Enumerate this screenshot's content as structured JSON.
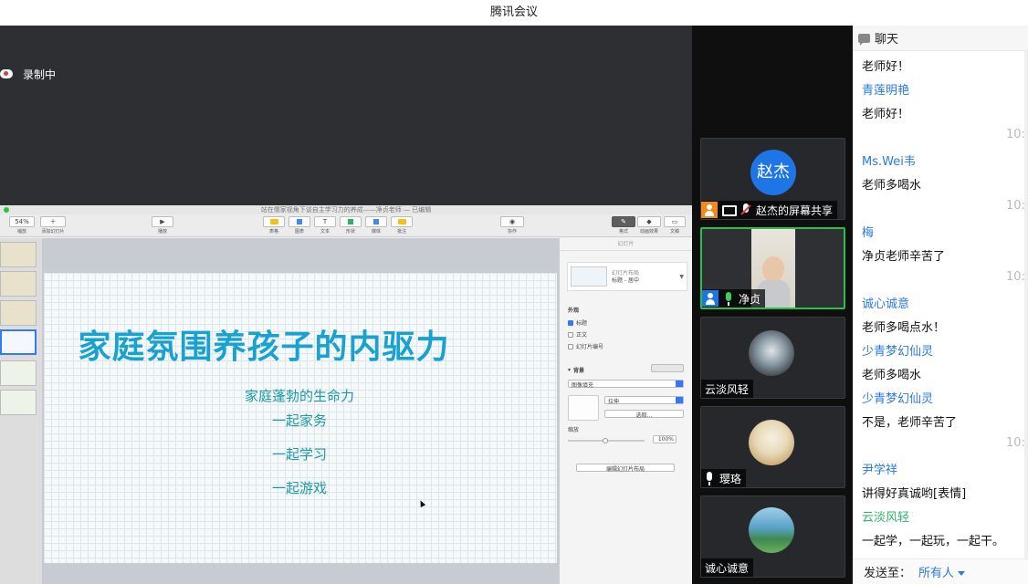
{
  "app_title": "腾讯会议",
  "recording": {
    "label": "录制中"
  },
  "keynote": {
    "doc_title": "站在儒家视角下谈自主学习力的养成——净贞老师 — 已编辑",
    "toolbar": [
      {
        "key": "zoom",
        "label": "缩放",
        "value": "54%"
      },
      {
        "key": "add_slide",
        "label": "添加幻灯片",
        "value": "＋"
      },
      {
        "key": "play",
        "label": "播放",
        "value": "▶"
      },
      {
        "key": "table",
        "label": "表格"
      },
      {
        "key": "chart",
        "label": "图表"
      },
      {
        "key": "text",
        "label": "文本",
        "value": "T"
      },
      {
        "key": "shape",
        "label": "形状"
      },
      {
        "key": "media",
        "label": "媒体"
      },
      {
        "key": "comment",
        "label": "批注"
      },
      {
        "key": "collab",
        "label": "协作"
      },
      {
        "key": "format",
        "label": "格式"
      },
      {
        "key": "animate",
        "label": "动画效果"
      },
      {
        "key": "document",
        "label": "文稿"
      }
    ],
    "slide": {
      "title": "家庭氛围养孩子的内驱力",
      "lines": [
        "家庭蓬勃的生命力",
        "一起家务",
        "一起学习",
        "一起游戏"
      ]
    },
    "inspector": {
      "header": "幻灯片",
      "layout_label": "幻灯片布局",
      "layout_value": "标题 - 居中",
      "appearance": "外观",
      "checkboxes": [
        {
          "label": "标题",
          "checked": true
        },
        {
          "label": "正文",
          "checked": false
        },
        {
          "label": "幻灯片编号",
          "checked": false
        }
      ],
      "background": "背景",
      "fill_type": "图像填充",
      "stretch": "拉伸",
      "choose": "选取...",
      "scale_label": "缩放",
      "scale_value": "100%",
      "edit_layout": "编辑幻灯片布局"
    }
  },
  "participants": [
    {
      "name": "赵杰的屏幕共享",
      "avatar_text": "赵杰",
      "avatar_color": "#1e76e6"
    },
    {
      "name": "净贞"
    },
    {
      "name": "云淡风轻"
    },
    {
      "name": "璎珞"
    },
    {
      "name": "诚心诚意"
    }
  ],
  "chat": {
    "title": "聊天",
    "messages": [
      {
        "type": "text",
        "text": "老师好！"
      },
      {
        "type": "sender",
        "text": "青莲明艳"
      },
      {
        "type": "text",
        "text": "老师好！"
      },
      {
        "type": "time",
        "text": "10:"
      },
      {
        "type": "sender",
        "text": "Ms.Wei韦"
      },
      {
        "type": "text",
        "text": "老师多喝水"
      },
      {
        "type": "time",
        "text": "10:"
      },
      {
        "type": "sender",
        "text": "梅"
      },
      {
        "type": "text",
        "text": "净贞老师辛苦了"
      },
      {
        "type": "time",
        "text": "10:"
      },
      {
        "type": "sender",
        "text": "诚心诚意"
      },
      {
        "type": "text",
        "text": "老师多喝点水！"
      },
      {
        "type": "sender",
        "text": "少青梦幻仙灵"
      },
      {
        "type": "text",
        "text": "老师多喝水"
      },
      {
        "type": "sender",
        "text": "少青梦幻仙灵"
      },
      {
        "type": "text",
        "text": "不是，老师辛苦了"
      },
      {
        "type": "time",
        "text": "10:"
      },
      {
        "type": "sender",
        "text": "尹学祥"
      },
      {
        "type": "text",
        "text": "讲得好真诚哟[表情]"
      },
      {
        "type": "sender_green",
        "text": "云淡风轻"
      },
      {
        "type": "text",
        "text": "一起学，一起玩，一起干。"
      }
    ],
    "send_to_label": "发送至：",
    "send_to_value": "所有人"
  }
}
